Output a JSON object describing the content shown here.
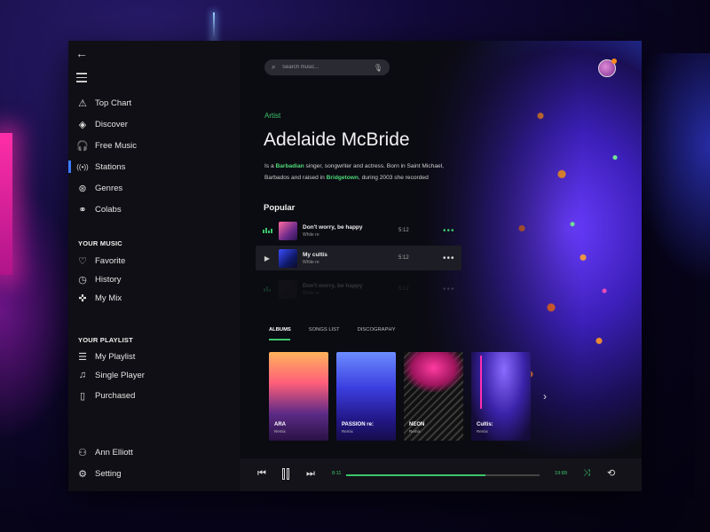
{
  "sidebar": {
    "nav": [
      {
        "icon": "top-chart-icon",
        "glyph": "⚠",
        "label": "Top Chart"
      },
      {
        "icon": "discover-icon",
        "glyph": "◈",
        "label": "Discover"
      },
      {
        "icon": "headphones-icon",
        "glyph": "🎧",
        "label": "Free Music"
      },
      {
        "icon": "stations-icon",
        "glyph": "((•))",
        "label": "Stations",
        "active": true
      },
      {
        "icon": "genres-icon",
        "glyph": "⊛",
        "label": "Genres"
      },
      {
        "icon": "colabs-icon",
        "glyph": "⚭",
        "label": "Colabs"
      }
    ],
    "your_music_heading": "YOUR MUSIC",
    "your_music": [
      {
        "icon": "heart-icon",
        "glyph": "♡",
        "label": "Favorite"
      },
      {
        "icon": "history-icon",
        "glyph": "◷",
        "label": "History"
      },
      {
        "icon": "mix-icon",
        "glyph": "✜",
        "label": "My Mix"
      }
    ],
    "playlist_heading": "YOUR PLAYLIST",
    "playlist": [
      {
        "icon": "playlist-icon",
        "glyph": "☰",
        "label": "My Playlist"
      },
      {
        "icon": "music-note-icon",
        "glyph": "♫",
        "label": "Single Player"
      },
      {
        "icon": "purchased-icon",
        "glyph": "▯",
        "label": "Purchased"
      }
    ],
    "user": {
      "icon": "user-icon",
      "glyph": "⚇",
      "label": "Ann Elliott"
    },
    "setting": {
      "icon": "gear-icon",
      "glyph": "⚙",
      "label": "Setting"
    }
  },
  "search": {
    "placeholder": "Search music..."
  },
  "artist": {
    "tag": "Artist",
    "name": "Adelaide McBride",
    "bio_prefix": "Is a ",
    "bio_link1": "Barbadian",
    "bio_mid": " singer, songwriter and actress. Born in Saint Michael, Barbados and raised in ",
    "bio_link2": "Bridgetown",
    "bio_suffix": ", during 2003 she recorded"
  },
  "popular": {
    "heading": "Popular",
    "tracks": [
      {
        "title": "Don't worry, be happy",
        "artist": "White re",
        "duration": "5:12",
        "more": "•••"
      },
      {
        "title": "My cultis",
        "artist": "White re",
        "duration": "5:12",
        "more": "•••"
      },
      {
        "title": "Don't worry, be happy",
        "artist": "White re",
        "duration": "5:12",
        "more": "•••"
      }
    ]
  },
  "tabs": [
    "ALBUMS",
    "SONGS LIST",
    "DISCOGRAPHY"
  ],
  "albums": [
    {
      "title": "ARA",
      "artist": "Remix"
    },
    {
      "title": "PASSION re:",
      "artist": "Remix"
    },
    {
      "title": "NEON",
      "artist": "Remix"
    },
    {
      "title": "Cultis:",
      "artist": "Remix"
    }
  ],
  "player": {
    "elapsed": "8:11",
    "total": "19:89",
    "progress": 0.72
  },
  "colors": {
    "accent": "#3cc66b",
    "active_nav": "#3b7bff",
    "avatar_dot": "#ff8a1f"
  }
}
